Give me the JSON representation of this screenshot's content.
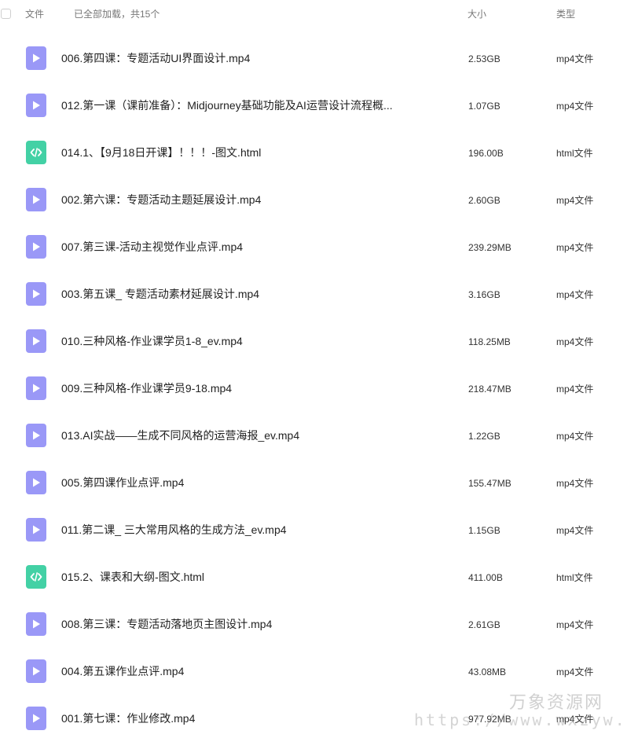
{
  "header": {
    "file_label": "文件",
    "loaded_label": "已全部加载，共15个",
    "size_label": "大小",
    "type_label": "类型"
  },
  "files": [
    {
      "icon": "video-file-icon",
      "name": "006.第四课：专题活动UI界面设计.mp4",
      "size": "2.53GB",
      "type": "mp4文件"
    },
    {
      "icon": "video-file-icon",
      "name": "012.第一课（课前准备）：Midjourney基础功能及AI运营设计流程概...",
      "size": "1.07GB",
      "type": "mp4文件"
    },
    {
      "icon": "html-file-icon",
      "name": "014.1、【9月18日开课】！！！-图文.html",
      "size": "196.00B",
      "type": "html文件"
    },
    {
      "icon": "video-file-icon",
      "name": "002.第六课：专题活动主题延展设计.mp4",
      "size": "2.60GB",
      "type": "mp4文件"
    },
    {
      "icon": "video-file-icon",
      "name": "007.第三课-活动主视觉作业点评.mp4",
      "size": "239.29MB",
      "type": "mp4文件"
    },
    {
      "icon": "video-file-icon",
      "name": "003.第五课_ 专题活动素材延展设计.mp4",
      "size": "3.16GB",
      "type": "mp4文件"
    },
    {
      "icon": "video-file-icon",
      "name": "010.三种风格-作业课学员1-8_ev.mp4",
      "size": "118.25MB",
      "type": "mp4文件"
    },
    {
      "icon": "video-file-icon",
      "name": "009.三种风格-作业课学员9-18.mp4",
      "size": "218.47MB",
      "type": "mp4文件"
    },
    {
      "icon": "video-file-icon",
      "name": "013.AI实战——生成不同风格的运营海报_ev.mp4",
      "size": "1.22GB",
      "type": "mp4文件"
    },
    {
      "icon": "video-file-icon",
      "name": "005.第四课作业点评.mp4",
      "size": "155.47MB",
      "type": "mp4文件"
    },
    {
      "icon": "video-file-icon",
      "name": "011.第二课_ 三大常用风格的生成方法_ev.mp4",
      "size": "1.15GB",
      "type": "mp4文件"
    },
    {
      "icon": "html-file-icon",
      "name": "015.2、课表和大纲-图文.html",
      "size": "411.00B",
      "type": "html文件"
    },
    {
      "icon": "video-file-icon",
      "name": "008.第三课：专题活动落地页主图设计.mp4",
      "size": "2.61GB",
      "type": "mp4文件"
    },
    {
      "icon": "video-file-icon",
      "name": "004.第五课作业点评.mp4",
      "size": "43.08MB",
      "type": "mp4文件"
    },
    {
      "icon": "video-file-icon",
      "name": "001.第七课：作业修改.mp4",
      "size": "977.92MB",
      "type": "mp4文件"
    }
  ],
  "watermark": {
    "title": "万象资源网",
    "url": "https://www.wxzyw.cn"
  },
  "colors": {
    "video_icon": "#9a98f7",
    "html_icon": "#43d1a5"
  }
}
